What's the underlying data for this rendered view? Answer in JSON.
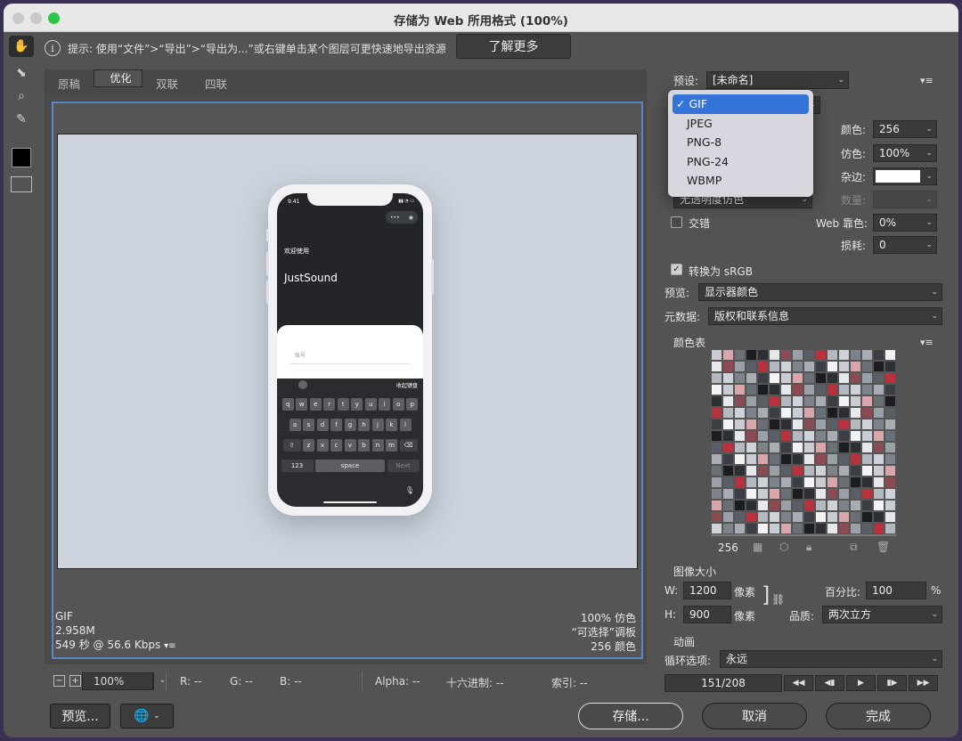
{
  "window": {
    "title": "存储为 Web 所用格式 (100%)"
  },
  "hint": {
    "icon": "info-icon",
    "text": "提示: 使用“文件”>“导出”>“导出为...”或右键单击某个图层可更快速地导出资源",
    "learn_more": "了解更多"
  },
  "tools": [
    "hand-tool-icon",
    "slice-select-tool-icon",
    "zoom-tool-icon",
    "eyedropper-tool-icon"
  ],
  "tabs": [
    "原稿",
    "优化",
    "双联",
    "四联"
  ],
  "selected_tab": "优化",
  "phone": {
    "time": "9:41",
    "welcome": "欢迎使用",
    "app_name": "JustSound",
    "input_placeholder": "账号",
    "kb_hide": "收起键盘",
    "row1": [
      "q",
      "w",
      "e",
      "r",
      "t",
      "y",
      "u",
      "i",
      "o",
      "p"
    ],
    "row2": [
      "a",
      "s",
      "d",
      "f",
      "g",
      "h",
      "j",
      "k",
      "l"
    ],
    "row3": [
      "z",
      "x",
      "c",
      "v",
      "b",
      "n",
      "m"
    ],
    "num_key": "123",
    "space_key": "space",
    "next_key": "Next"
  },
  "status": {
    "format": "GIF",
    "size": "2.958M",
    "time": "549 秒 @ 56.6 Kbps",
    "dither": "100% 仿色",
    "palette": "“可选择”调板",
    "colors": "256 颜色"
  },
  "bottom_bar": {
    "zoom": "100%",
    "r": "R: --",
    "g": "G: --",
    "b": "B: --",
    "alpha": "Alpha: --",
    "hex": "十六进制: --",
    "index": "索引: --"
  },
  "buttons": {
    "preview": "预览...",
    "save": "存储...",
    "cancel": "取消",
    "done": "完成"
  },
  "settings": {
    "preset_label": "预设:",
    "preset_value": "[未命名]",
    "colors_label": "颜色:",
    "colors_value": "256",
    "dither_label": "仿色:",
    "dither_value": "100%",
    "matte_label": "杂边:",
    "amount_label": "数量:",
    "transparency_dither": "无透明度仿色",
    "interlaced": "交错",
    "web_snap_label": "Web 靠色:",
    "web_snap_value": "0%",
    "lossy_label": "损耗:",
    "lossy_value": "0",
    "convert_srgb": "转换为 sRGB",
    "preview_label": "预览:",
    "preview_value": "显示器颜色",
    "metadata_label": "元数据:",
    "metadata_value": "版权和联系信息"
  },
  "format_menu": {
    "options": [
      "GIF",
      "JPEG",
      "PNG-8",
      "PNG-24",
      "WBMP"
    ],
    "selected": "GIF",
    "check": "✓"
  },
  "color_table": {
    "title": "颜色表",
    "count": "256"
  },
  "image_size": {
    "title": "图像大小",
    "w_label": "W:",
    "w": "1200",
    "h_label": "H:",
    "h": "900",
    "unit": "像素",
    "percent_label": "百分比:",
    "percent": "100",
    "percent_unit": "%",
    "quality_label": "品质:",
    "quality": "两次立方"
  },
  "animation": {
    "title": "动画",
    "loop_label": "循环选项:",
    "loop_value": "永远",
    "frame": "151/208"
  },
  "colors": {
    "accent": "#3474d9",
    "canvas_border": "#5a86c9",
    "panel": "#535353"
  }
}
